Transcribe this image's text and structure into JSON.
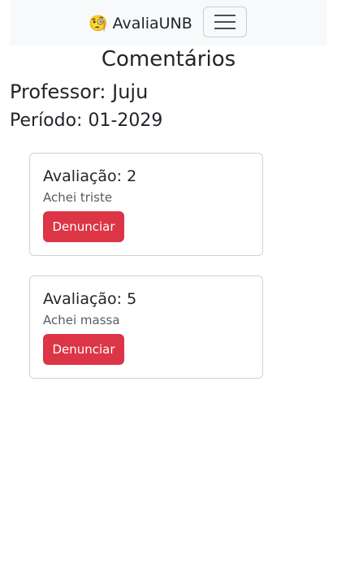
{
  "navbar": {
    "brand_emoji": "🧐",
    "brand_text": "AvaliaUNB",
    "toggler_icon": "hamburger-menu-icon"
  },
  "page": {
    "title": "Comentários",
    "professor": "Professor: Juju",
    "periodo": "Período: 01-2029"
  },
  "comments": [
    {
      "rating": "Avaliação: 2",
      "text": "Achei triste",
      "report_label": "Denunciar"
    },
    {
      "rating": "Avaliação: 5",
      "text": "Achei massa",
      "report_label": "Denunciar"
    }
  ],
  "colors": {
    "navbar_bg": "#f8f9fa",
    "danger": "#dc3545",
    "text": "#212529",
    "muted": "#555d63"
  }
}
